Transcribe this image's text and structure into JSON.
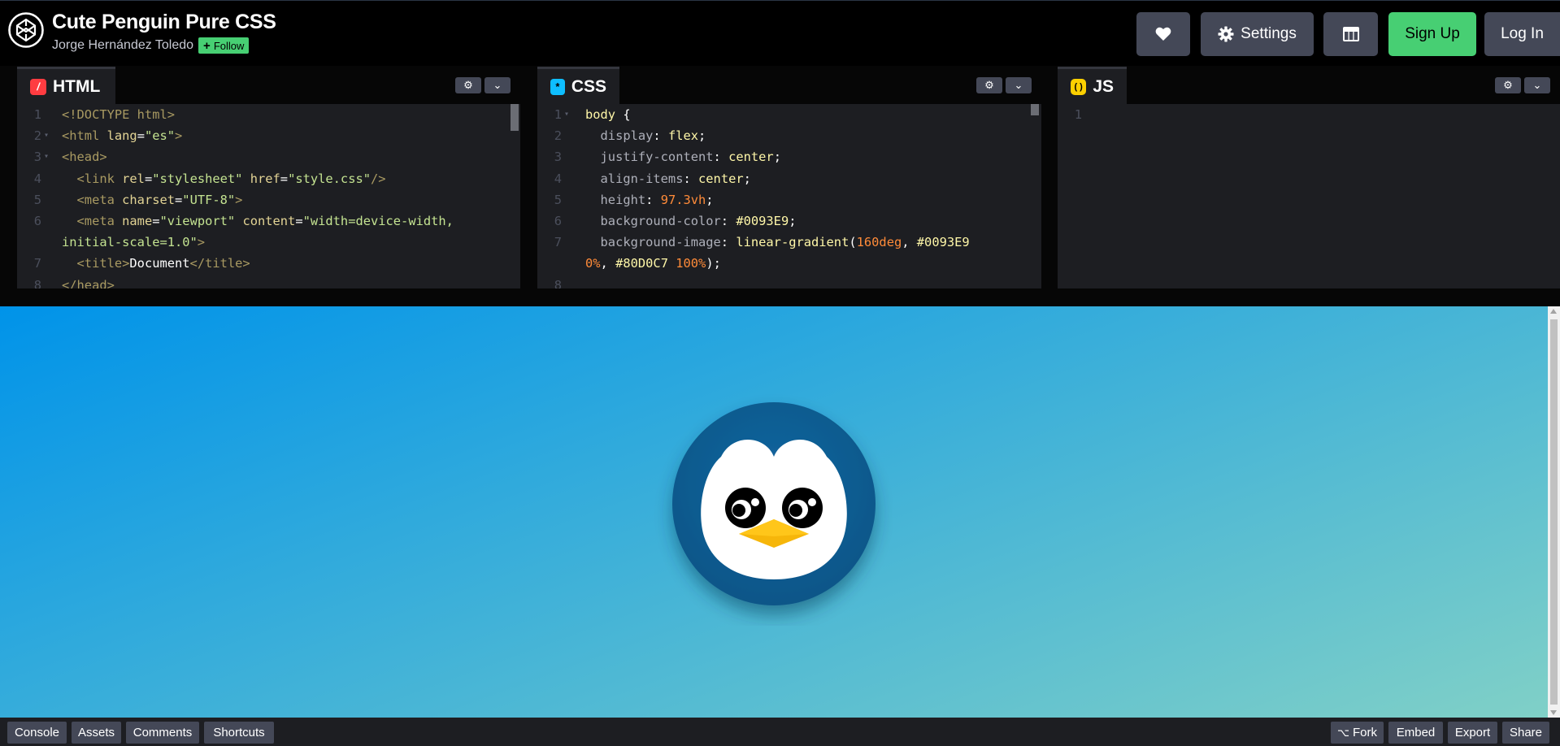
{
  "header": {
    "title": "Cute Penguin Pure CSS",
    "author": "Jorge Hernández Toledo",
    "follow_label": "Follow",
    "buttons": {
      "heart_icon": "heart-icon",
      "settings_label": "Settings",
      "layout_icon": "layout-grid-icon",
      "signup_label": "Sign Up",
      "login_label": "Log In"
    }
  },
  "editors": {
    "html": {
      "tab_label": "HTML",
      "icon_glyph": "/",
      "lines": [
        {
          "n": "1",
          "fold": false,
          "parts": [
            [
              "t-tag",
              "<!DOCTYPE html>"
            ]
          ]
        },
        {
          "n": "2",
          "fold": true,
          "parts": [
            [
              "t-tag",
              "<html "
            ],
            [
              "t-attr",
              "lang"
            ],
            [
              "t-pl",
              "="
            ],
            [
              "t-strc",
              "\"es\""
            ],
            [
              "t-tag",
              ">"
            ]
          ]
        },
        {
          "n": "3",
          "fold": true,
          "parts": [
            [
              "t-tag",
              "<head>"
            ]
          ]
        },
        {
          "n": "4",
          "fold": false,
          "parts": [
            [
              "t-tag",
              "  <link "
            ],
            [
              "t-attr",
              "rel"
            ],
            [
              "t-pl",
              "="
            ],
            [
              "t-strc",
              "\"stylesheet\""
            ],
            [
              "t-attr",
              " href"
            ],
            [
              "t-pl",
              "="
            ],
            [
              "t-strc",
              "\"style.css\""
            ],
            [
              "t-tag",
              "/>"
            ]
          ]
        },
        {
          "n": "5",
          "fold": false,
          "parts": [
            [
              "t-tag",
              "  <meta "
            ],
            [
              "t-attr",
              "charset"
            ],
            [
              "t-pl",
              "="
            ],
            [
              "t-strc",
              "\"UTF-8\""
            ],
            [
              "t-tag",
              ">"
            ]
          ]
        },
        {
          "n": "6",
          "fold": false,
          "parts": [
            [
              "t-tag",
              "  <meta "
            ],
            [
              "t-attr",
              "name"
            ],
            [
              "t-pl",
              "="
            ],
            [
              "t-strc",
              "\"viewport\""
            ],
            [
              "t-attr",
              " content"
            ],
            [
              "t-pl",
              "="
            ],
            [
              "t-strc",
              "\"width=device-width,"
            ]
          ]
        },
        {
          "n": "",
          "fold": false,
          "parts": [
            [
              "t-strc",
              "initial-scale=1.0\""
            ],
            [
              "t-tag",
              ">"
            ]
          ]
        },
        {
          "n": "7",
          "fold": false,
          "parts": [
            [
              "t-tag",
              "  <title>"
            ],
            [
              "t-pl",
              "Document"
            ],
            [
              "t-tag",
              "</title>"
            ]
          ]
        },
        {
          "n": "8",
          "fold": false,
          "parts": [
            [
              "t-tag",
              "</head>"
            ]
          ]
        }
      ]
    },
    "css": {
      "tab_label": "CSS",
      "icon_glyph": "*",
      "lines": [
        {
          "n": "1",
          "fold": true,
          "parts": [
            [
              "t-val",
              "body "
            ],
            [
              "t-pl",
              "{"
            ]
          ]
        },
        {
          "n": "2",
          "fold": false,
          "parts": [
            [
              "t-prop",
              "  display"
            ],
            [
              "t-pl",
              ": "
            ],
            [
              "t-val",
              "flex"
            ],
            [
              "t-pl",
              ";"
            ]
          ]
        },
        {
          "n": "3",
          "fold": false,
          "parts": [
            [
              "t-prop",
              "  justify-content"
            ],
            [
              "t-pl",
              ": "
            ],
            [
              "t-val",
              "center"
            ],
            [
              "t-pl",
              ";"
            ]
          ]
        },
        {
          "n": "4",
          "fold": false,
          "parts": [
            [
              "t-prop",
              "  align-items"
            ],
            [
              "t-pl",
              ": "
            ],
            [
              "t-val",
              "center"
            ],
            [
              "t-pl",
              ";"
            ]
          ]
        },
        {
          "n": "5",
          "fold": false,
          "parts": [
            [
              "t-prop",
              "  height"
            ],
            [
              "t-pl",
              ": "
            ],
            [
              "t-num",
              "97.3vh"
            ],
            [
              "t-pl",
              ";"
            ]
          ]
        },
        {
          "n": "6",
          "fold": false,
          "parts": [
            [
              "t-prop",
              "  background-color"
            ],
            [
              "t-pl",
              ": "
            ],
            [
              "t-val",
              "#0093E9"
            ],
            [
              "t-pl",
              ";"
            ]
          ]
        },
        {
          "n": "7",
          "fold": false,
          "parts": [
            [
              "t-prop",
              "  background-image"
            ],
            [
              "t-pl",
              ": "
            ],
            [
              "t-val",
              "linear-gradient"
            ],
            [
              "t-pl",
              "("
            ],
            [
              "t-num",
              "160deg"
            ],
            [
              "t-pl",
              ", "
            ],
            [
              "t-val",
              "#0093E9"
            ]
          ]
        },
        {
          "n": "",
          "fold": false,
          "parts": [
            [
              "t-num",
              "0%"
            ],
            [
              "t-pl",
              ", "
            ],
            [
              "t-val",
              "#80D0C7"
            ],
            [
              "t-pl",
              " "
            ],
            [
              "t-num",
              "100%"
            ],
            [
              "t-pl",
              ");"
            ]
          ]
        },
        {
          "n": "8",
          "fold": false,
          "parts": [
            [
              "t-pl",
              ""
            ]
          ]
        }
      ]
    },
    "js": {
      "tab_label": "JS",
      "icon_glyph": "( )",
      "lines": [
        {
          "n": "1",
          "fold": false,
          "parts": [
            [
              "t-pl",
              ""
            ]
          ]
        }
      ]
    }
  },
  "footer": {
    "left_buttons": [
      "Console",
      "Assets",
      "Comments",
      "Shortcuts"
    ],
    "right_buttons": [
      "Fork",
      "Embed",
      "Export",
      "Share"
    ],
    "fork_icon": "fork-icon"
  },
  "colors": {
    "signup": "#47cf73",
    "button": "#444857",
    "gradient_start": "#0093E9",
    "gradient_end": "#80D0C7"
  }
}
